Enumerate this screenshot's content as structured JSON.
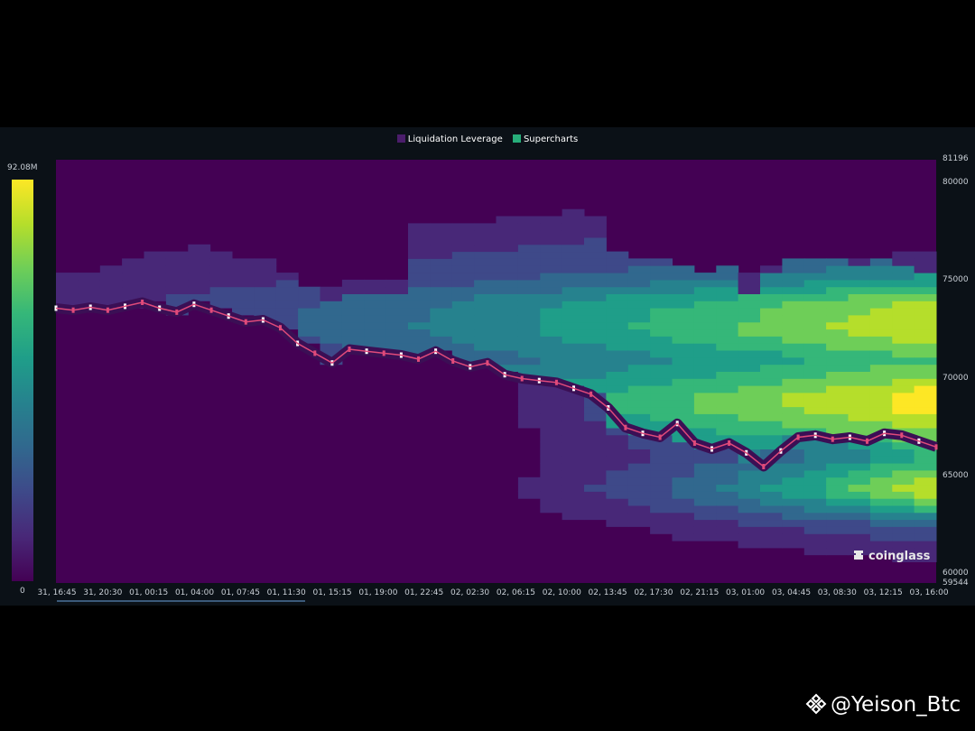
{
  "legend": {
    "items": [
      {
        "label": "Liquidation Leverage",
        "color": "#4b1d6b"
      },
      {
        "label": "Supercharts",
        "color": "#27ae7a"
      }
    ]
  },
  "colorbar": {
    "max_label": "92.08M",
    "min_label": "0"
  },
  "brand": {
    "name": "coinglass"
  },
  "watermark": {
    "handle": "@Yeison_Btc"
  },
  "colors": {
    "viridis": [
      "#440154",
      "#482878",
      "#3e4989",
      "#31688e",
      "#26828e",
      "#1f9e89",
      "#35b779",
      "#6ece58",
      "#b5de2b",
      "#fde725"
    ],
    "candle_up": "#e04a7a",
    "candle_down": "#e04a7a",
    "background": "#0b1117"
  },
  "chart_data": {
    "type": "heatmap",
    "title": "",
    "series_names": [
      "Liquidation Leverage",
      "Supercharts"
    ],
    "x_tick_labels": [
      "31, 16:45",
      "31, 20:30",
      "01, 00:15",
      "01, 04:00",
      "01, 07:45",
      "01, 11:30",
      "01, 15:15",
      "01, 19:00",
      "01, 22:45",
      "02, 02:30",
      "02, 06:15",
      "02, 10:00",
      "02, 13:45",
      "02, 17:30",
      "02, 21:15",
      "03, 01:00",
      "03, 04:45",
      "03, 08:30",
      "03, 12:15",
      "03, 16:00"
    ],
    "y_ticks": [
      60000,
      65000,
      70000,
      75000,
      80000
    ],
    "y_top_label": "81196",
    "y_bottom_label": "59544",
    "ylim": [
      59544,
      81196
    ],
    "colorbar_range": [
      0,
      92080000
    ],
    "price_path": [
      [
        0,
        73600
      ],
      [
        1,
        73500
      ],
      [
        2,
        73650
      ],
      [
        3,
        73500
      ],
      [
        4,
        73700
      ],
      [
        5,
        73900
      ],
      [
        6,
        73600
      ],
      [
        7,
        73400
      ],
      [
        8,
        73800
      ],
      [
        9,
        73500
      ],
      [
        10,
        73200
      ],
      [
        11,
        72900
      ],
      [
        12,
        73000
      ],
      [
        13,
        72600
      ],
      [
        14,
        71800
      ],
      [
        15,
        71300
      ],
      [
        16,
        70800
      ],
      [
        17,
        71500
      ],
      [
        18,
        71400
      ],
      [
        19,
        71300
      ],
      [
        20,
        71200
      ],
      [
        21,
        71000
      ],
      [
        22,
        71400
      ],
      [
        23,
        70900
      ],
      [
        24,
        70600
      ],
      [
        25,
        70800
      ],
      [
        26,
        70200
      ],
      [
        27,
        70000
      ],
      [
        28,
        69900
      ],
      [
        29,
        69800
      ],
      [
        30,
        69500
      ],
      [
        31,
        69200
      ],
      [
        32,
        68500
      ],
      [
        33,
        67500
      ],
      [
        34,
        67200
      ],
      [
        35,
        67000
      ],
      [
        36,
        67700
      ],
      [
        37,
        66700
      ],
      [
        38,
        66400
      ],
      [
        39,
        66700
      ],
      [
        40,
        66200
      ],
      [
        41,
        65500
      ],
      [
        42,
        66300
      ],
      [
        43,
        67000
      ],
      [
        44,
        67100
      ],
      [
        45,
        66900
      ],
      [
        46,
        67000
      ],
      [
        47,
        66800
      ],
      [
        48,
        67200
      ],
      [
        49,
        67100
      ],
      [
        50,
        66800
      ],
      [
        51,
        66500
      ]
    ],
    "liquidation_bands": [
      {
        "price": 80000,
        "intensity": 0.05
      },
      {
        "price": 78000,
        "intensity": 0.15
      },
      {
        "price": 76500,
        "intensity": 0.35
      },
      {
        "price": 75500,
        "intensity": 0.45
      },
      {
        "price": 74800,
        "intensity": 0.6
      },
      {
        "price": 74200,
        "intensity": 0.8
      },
      {
        "price": 73600,
        "intensity": 0.9
      },
      {
        "price": 72500,
        "intensity": 0.95
      },
      {
        "price": 71800,
        "intensity": 0.85
      },
      {
        "price": 71000,
        "intensity": 0.7
      },
      {
        "price": 70000,
        "intensity": 0.85
      },
      {
        "price": 69200,
        "intensity": 1.0
      },
      {
        "price": 68400,
        "intensity": 1.0
      },
      {
        "price": 66000,
        "intensity": 0.6
      },
      {
        "price": 65200,
        "intensity": 0.8
      },
      {
        "price": 64300,
        "intensity": 0.95
      },
      {
        "price": 63500,
        "intensity": 0.7
      },
      {
        "price": 62500,
        "intensity": 0.3
      },
      {
        "price": 61500,
        "intensity": 0.15
      },
      {
        "price": 60500,
        "intensity": 0.05
      }
    ]
  }
}
